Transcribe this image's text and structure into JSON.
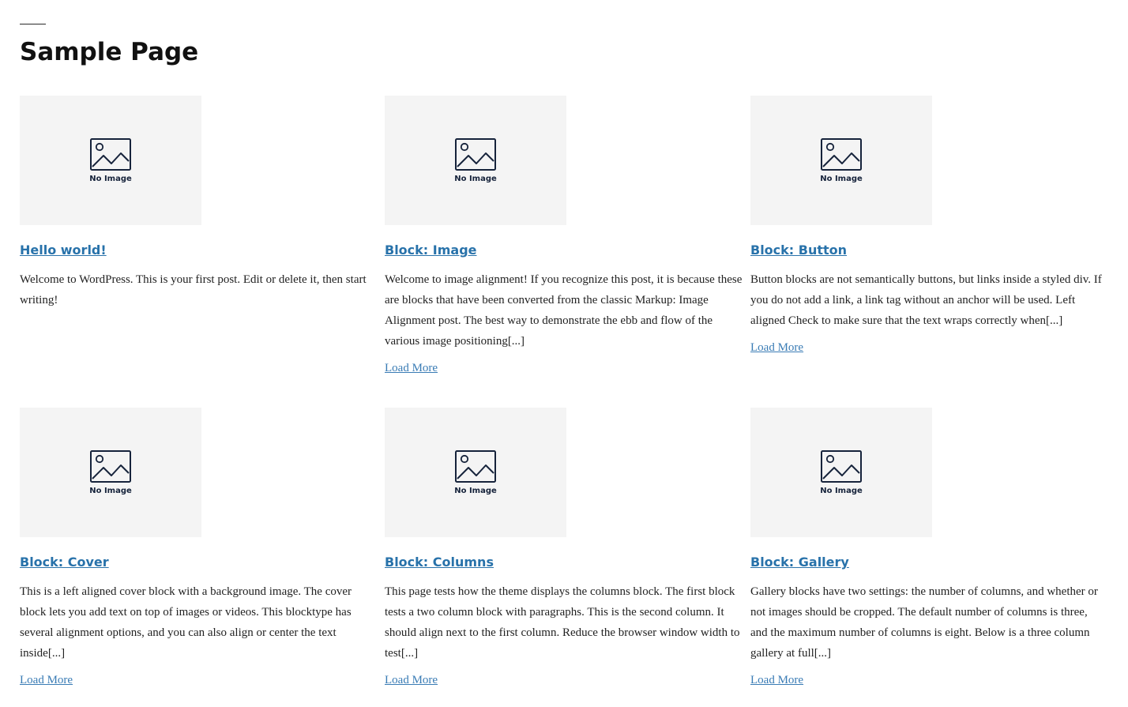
{
  "page": {
    "title": "Sample Page"
  },
  "placeholder": {
    "label": "No Image",
    "icon": "image-placeholder-icon",
    "background": "#f4f4f4",
    "icon_color": "#16233b"
  },
  "colors": {
    "link": "#2872aa",
    "text": "#222222",
    "title": "#111111"
  },
  "posts": [
    {
      "title": "Hello world!",
      "excerpt": "Welcome to WordPress. This is your first post. Edit or delete it, then start writing!",
      "load_more": null
    },
    {
      "title": "Block: Image",
      "excerpt": "Welcome to image alignment! If you recognize this post, it is because these are blocks that have been converted from the classic Markup: Image Alignment post. The best way to demonstrate the ebb and flow of the various image positioning[...]",
      "load_more": "Load More"
    },
    {
      "title": "Block: Button",
      "excerpt": "Button blocks are not semantically buttons, but links inside a styled div.  If you do not add a link, a link tag without an anchor will be used. Left aligned Check to make sure that the text wraps correctly when[...]",
      "load_more": "Load More"
    },
    {
      "title": "Block: Cover",
      "excerpt": "This is a left aligned cover block with a background image. The cover block lets you add text on top of images or videos. This blocktype has several alignment options, and you can also align or center the text inside[...]",
      "load_more": "Load More"
    },
    {
      "title": "Block: Columns",
      "excerpt": "This page tests how the theme displays the columns block. The first block tests a two column block with paragraphs. This is the second column. It should align next to the first column. Reduce the browser window width to test[...]",
      "load_more": "Load More"
    },
    {
      "title": "Block: Gallery",
      "excerpt": "Gallery blocks have two settings: the number of columns, and whether or not images should be cropped. The default number of columns is three, and the maximum number of columns is eight. Below is a three column gallery at full[...]",
      "load_more": "Load More"
    }
  ]
}
